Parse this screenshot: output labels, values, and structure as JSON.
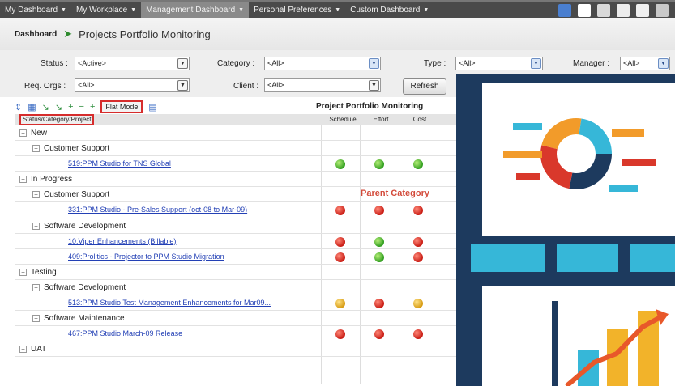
{
  "nav": {
    "items": [
      {
        "label": "My Dashboard",
        "active": false
      },
      {
        "label": "My Workplace",
        "active": false
      },
      {
        "label": "Management Dashboard",
        "active": true
      },
      {
        "label": "Personal Preferences",
        "active": false
      },
      {
        "label": "Custom Dashboard",
        "active": false
      }
    ]
  },
  "header": {
    "breadcrumb": "Dashboard",
    "title": "Projects Portfolio Monitoring"
  },
  "filters": {
    "status_label": "Status :",
    "status_value": "<Active>",
    "category_label": "Category :",
    "category_value": "<All>",
    "type_label": "Type :",
    "type_value": "<All>",
    "manager_label": "Manager :",
    "manager_value": "<All>",
    "reqorgs_label": "Req. Orgs :",
    "reqorgs_value": "<All>",
    "client_label": "Client :",
    "client_value": "<All>",
    "refresh_label": "Refresh"
  },
  "toolbar": {
    "flat_mode_label": "Flat Mode"
  },
  "grid": {
    "title": "Project Portfolio Monitoring",
    "col_project": "Status/Category/Project",
    "col_schedule": "Schedule",
    "col_effort": "Effort",
    "col_cost": "Cost",
    "rows": [
      {
        "level": 0,
        "text": "New",
        "link": false,
        "dots": []
      },
      {
        "level": 1,
        "text": "Customer Support",
        "link": false,
        "dots": []
      },
      {
        "level": 2,
        "text": "519:PPM Studio for TNS Global",
        "link": true,
        "dots": [
          "green",
          "green",
          "green"
        ]
      },
      {
        "level": 0,
        "text": "In Progress",
        "link": false,
        "dots": []
      },
      {
        "level": 1,
        "text": "Customer Support",
        "link": false,
        "dots": []
      },
      {
        "level": 2,
        "text": "331:PPM Studio - Pre-Sales Support (oct-08 to Mar-09)",
        "link": true,
        "dots": [
          "red",
          "red",
          "red"
        ]
      },
      {
        "level": 1,
        "text": "Software Development",
        "link": false,
        "dots": []
      },
      {
        "level": 2,
        "text": "10:Viper Enhancements (Billable)",
        "link": true,
        "dots": [
          "red",
          "green",
          "red"
        ]
      },
      {
        "level": 2,
        "text": "409:Prolitics - Projector to PPM Studio Migration",
        "link": true,
        "dots": [
          "red",
          "green",
          "red"
        ]
      },
      {
        "level": 0,
        "text": "Testing",
        "link": false,
        "dots": []
      },
      {
        "level": 1,
        "text": "Software Development",
        "link": false,
        "dots": []
      },
      {
        "level": 2,
        "text": "513:PPM Studio Test Management Enhancements for Mar09...",
        "link": true,
        "dots": [
          "yellow",
          "red",
          "yellow"
        ]
      },
      {
        "level": 1,
        "text": "Software Maintenance",
        "link": false,
        "dots": []
      },
      {
        "level": 2,
        "text": "467:PPM Studio March-09 Release",
        "link": true,
        "dots": [
          "red",
          "red",
          "red"
        ]
      },
      {
        "level": 0,
        "text": "UAT",
        "link": false,
        "dots": []
      }
    ]
  },
  "annotation": "Parent Category",
  "colors": {
    "nav_bg": "#4a4a4a",
    "illus_bg": "#1d3a5e",
    "accent_red": "#d62c2c",
    "status_green": "#2f9d1e",
    "status_red": "#c81a12",
    "status_yellow": "#d69a10"
  }
}
